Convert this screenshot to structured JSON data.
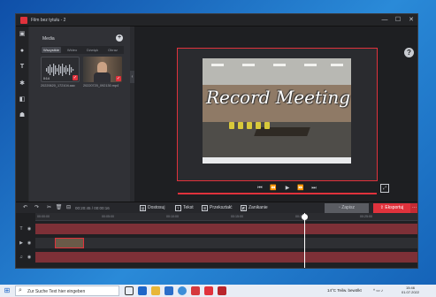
{
  "window": {
    "title": "Film bez tytułu - 2",
    "minimize": "—",
    "maximize": "☐",
    "close": "✕"
  },
  "rail_icons": [
    "media-icon",
    "audio-icon",
    "text-icon",
    "effects-icon",
    "transitions-icon",
    "stickers-icon"
  ],
  "media": {
    "label": "Media",
    "add": "+",
    "tabs": [
      "Wszystkie",
      "Wideo",
      "Dźwięk",
      "Obraz"
    ],
    "active_tab": "Wszystkie",
    "items": [
      {
        "name": "20220620_172104.aac",
        "duration": "0:14"
      },
      {
        "name": "20220720_092130.mp4",
        "duration": ""
      }
    ]
  },
  "preview": {
    "overlay_text": "Record Meeting",
    "help": "?",
    "progress_fraction": 1.0
  },
  "toolbar": {
    "time": "00:20:45 / 00:00:16",
    "tools": [
      "Dostosuj",
      "Tekst",
      "Przekształć",
      "Zanikanie"
    ],
    "save": "Zapisz",
    "export": "Eksportuj",
    "more": "···"
  },
  "timeline": {
    "ticks": [
      "00:00:00",
      "00:05:00",
      "00:10:00",
      "00:15:00",
      "00:20:00",
      "00:25:00"
    ],
    "playhead": "00:20:45"
  },
  "taskbar": {
    "search_placeholder": "Zur Suche Text hier eingeben",
    "weather": "14°C  Teilw. bewölkt",
    "time": "15:46",
    "date": "01.07.2022"
  }
}
